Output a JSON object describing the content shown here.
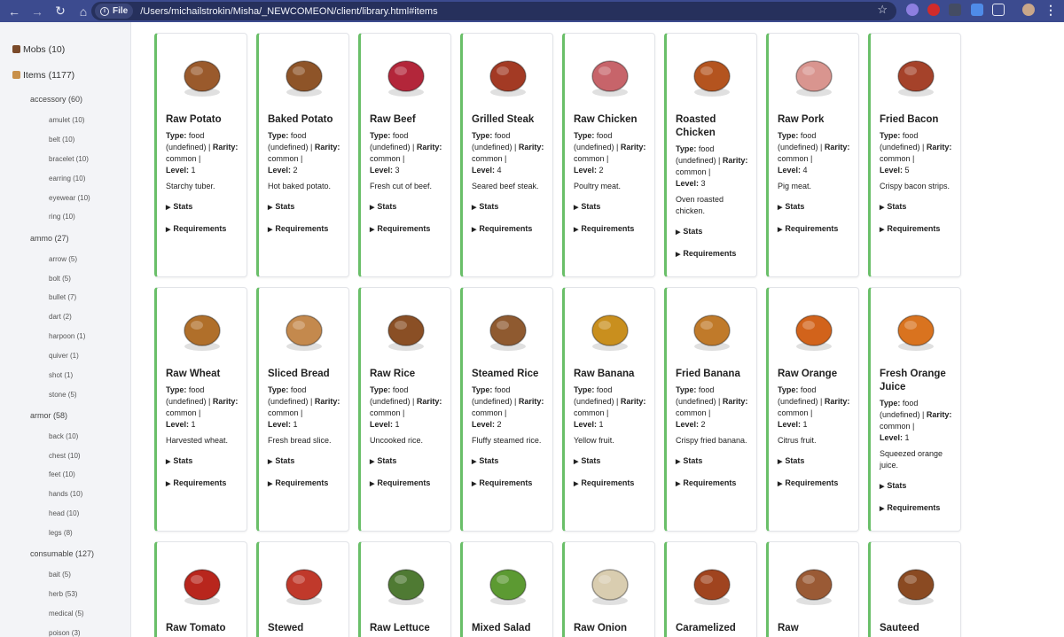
{
  "browser": {
    "file_chip": "File",
    "url": "/Users/michailstrokin/Misha/_NEWCOMEON/client/library.html#items"
  },
  "sidebar": {
    "mobs": "Mobs (10)",
    "items": "Items (1177)",
    "groups": [
      {
        "label": "accessory (60)",
        "subs": [
          "amulet (10)",
          "belt (10)",
          "bracelet (10)",
          "earring (10)",
          "eyewear (10)",
          "ring (10)"
        ]
      },
      {
        "label": "ammo (27)",
        "subs": [
          "arrow (5)",
          "bolt (5)",
          "bullet (7)",
          "dart (2)",
          "harpoon (1)",
          "quiver (1)",
          "shot (1)",
          "stone (5)"
        ]
      },
      {
        "label": "armor (58)",
        "subs": [
          "back (10)",
          "chest (10)",
          "feet (10)",
          "hands (10)",
          "head (10)",
          "legs (8)"
        ]
      },
      {
        "label": "consumable (127)",
        "subs": [
          "bait (5)",
          "herb (53)",
          "medical (5)",
          "poison (3)"
        ]
      }
    ]
  },
  "labels": {
    "type": "Type:",
    "rarity": "Rarity:",
    "level": "Level:",
    "stats": "Stats",
    "requirements": "Requirements"
  },
  "cards": [
    {
      "name": "Raw Potato",
      "type": "food (undefined) |",
      "rarity": "common |",
      "level": "1",
      "desc": "Starchy tuber.",
      "icon": "potato-icon",
      "color": "#9a5a2c"
    },
    {
      "name": "Baked Potato",
      "type": "food (undefined) |",
      "rarity": "common |",
      "level": "2",
      "desc": "Hot baked potato.",
      "icon": "baked-potato-icon",
      "color": "#8e5428"
    },
    {
      "name": "Raw Beef",
      "type": "food (undefined) |",
      "rarity": "common |",
      "level": "3",
      "desc": "Fresh cut of beef.",
      "icon": "beef-icon",
      "color": "#b3263a"
    },
    {
      "name": "Grilled Steak",
      "type": "food (undefined) |",
      "rarity": "common |",
      "level": "4",
      "desc": "Seared beef steak.",
      "icon": "steak-icon",
      "color": "#a33a24"
    },
    {
      "name": "Raw Chicken",
      "type": "food (undefined) |",
      "rarity": "common |",
      "level": "2",
      "desc": "Poultry meat.",
      "icon": "chicken-leg-icon",
      "color": "#c7646a"
    },
    {
      "name": "Roasted Chicken",
      "type": "food (undefined) |",
      "rarity": "common |",
      "level": "3",
      "desc": "Oven roasted chicken.",
      "icon": "roast-chicken-icon",
      "color": "#b4541f"
    },
    {
      "name": "Raw Pork",
      "type": "food (undefined) |",
      "rarity": "common |",
      "level": "4",
      "desc": "Pig meat.",
      "icon": "pork-icon",
      "color": "#d9958f"
    },
    {
      "name": "Fried Bacon",
      "type": "food (undefined) |",
      "rarity": "common |",
      "level": "5",
      "desc": "Crispy bacon strips.",
      "icon": "bacon-icon",
      "color": "#a5422a"
    },
    {
      "name": "Raw Wheat",
      "type": "food (undefined) |",
      "rarity": "common |",
      "level": "1",
      "desc": "Harvested wheat.",
      "icon": "wheat-icon",
      "color": "#b06f2a"
    },
    {
      "name": "Sliced Bread",
      "type": "food (undefined) |",
      "rarity": "common |",
      "level": "1",
      "desc": "Fresh bread slice.",
      "icon": "bread-icon",
      "color": "#c4894d"
    },
    {
      "name": "Raw Rice",
      "type": "food (undefined) |",
      "rarity": "common |",
      "level": "1",
      "desc": "Uncooked rice.",
      "icon": "rice-sack-icon",
      "color": "#8a4f25"
    },
    {
      "name": "Steamed Rice",
      "type": "food (undefined) |",
      "rarity": "common |",
      "level": "2",
      "desc": "Fluffy steamed rice.",
      "icon": "rice-bowl-icon",
      "color": "#8f5a30"
    },
    {
      "name": "Raw Banana",
      "type": "food (undefined) |",
      "rarity": "common |",
      "level": "1",
      "desc": "Yellow fruit.",
      "icon": "banana-icon",
      "color": "#c98f1e"
    },
    {
      "name": "Fried Banana",
      "type": "food (undefined) |",
      "rarity": "common |",
      "level": "2",
      "desc": "Crispy fried banana.",
      "icon": "fried-banana-icon",
      "color": "#c07a2a"
    },
    {
      "name": "Raw Orange",
      "type": "food (undefined) |",
      "rarity": "common |",
      "level": "1",
      "desc": "Citrus fruit.",
      "icon": "orange-icon",
      "color": "#d2631b"
    },
    {
      "name": "Fresh Orange Juice",
      "type": "food (undefined) |",
      "rarity": "common |",
      "level": "1",
      "desc": "Squeezed orange juice.",
      "icon": "juice-glass-icon",
      "color": "#d9731f"
    },
    {
      "name": "Raw Tomato",
      "icon": "tomato-icon",
      "color": "#b8261d"
    },
    {
      "name": "Stewed",
      "icon": "stew-bowl-icon",
      "color": "#c0392b"
    },
    {
      "name": "Raw Lettuce",
      "icon": "lettuce-icon",
      "color": "#4f7a33"
    },
    {
      "name": "Mixed Salad",
      "icon": "salad-icon",
      "color": "#5c9a32"
    },
    {
      "name": "Raw Onion",
      "icon": "onion-icon",
      "color": "#d9cdb0"
    },
    {
      "name": "Caramelized",
      "icon": "caramelized-icon",
      "color": "#a0441f"
    },
    {
      "name": "Raw",
      "icon": "mushroom-icon",
      "color": "#9a5a35"
    },
    {
      "name": "Sauteed",
      "icon": "sauteed-pan-icon",
      "color": "#8a4a22"
    }
  ],
  "colors": {
    "accent": "#6abf69",
    "toolbar": "#3c4b8f"
  }
}
